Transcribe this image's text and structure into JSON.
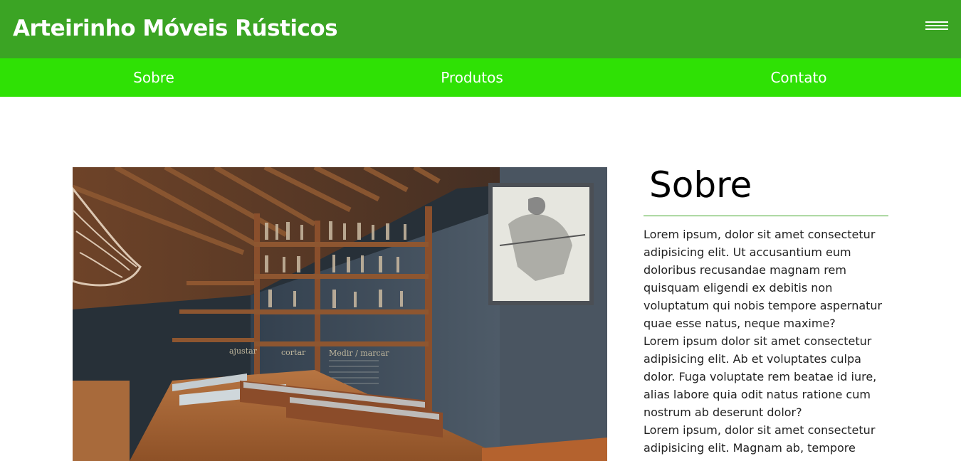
{
  "header": {
    "site_title": "Arteirinho Móveis Rústicos",
    "menu_icon": "hamburger-menu-icon",
    "background_color": "#3ba424"
  },
  "nav": {
    "background_color": "#2fe105",
    "items": [
      {
        "label": "Sobre"
      },
      {
        "label": "Produtos"
      },
      {
        "label": "Contato"
      }
    ]
  },
  "main": {
    "image": {
      "subject": "rustic woodworking tool museum with tools on wooden shelves",
      "panel_labels": [
        "ajustar",
        "cortar",
        "Medir / marcar"
      ]
    },
    "about": {
      "title": "Sobre",
      "paragraphs": [
        "Lorem ipsum, dolor sit amet consectetur adipisicing elit. Ut accusantium eum doloribus recusandae magnam rem quisquam eligendi ex debitis non voluptatum qui nobis tempore aspernatur quae esse natus, neque maxime?",
        "Lorem ipsum dolor sit amet consectetur adipisicing elit. Ab et voluptates culpa dolor. Fuga voluptate rem beatae id iure, alias labore quia odit natus ratione cum nostrum ab deserunt dolor?",
        "Lorem ipsum, dolor sit amet consectetur adipisicing elit. Magnam ab, tempore"
      ]
    }
  }
}
